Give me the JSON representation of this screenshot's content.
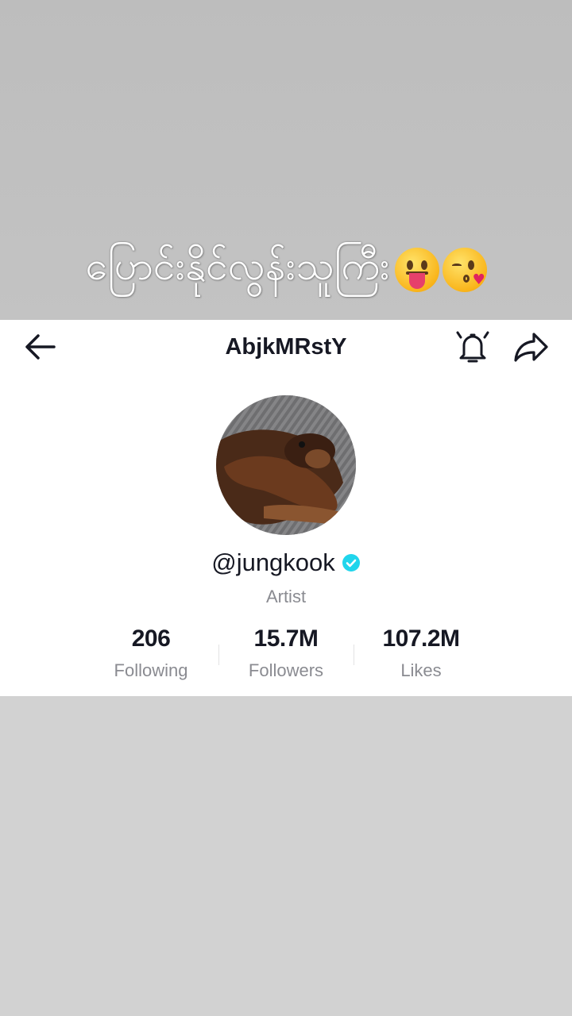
{
  "overlay": {
    "caption": "ပြောင်းနိုင်လွန်းသူကြီး",
    "emojis": [
      "face-with-tongue",
      "face-blowing-kiss"
    ]
  },
  "header": {
    "title": "AbjkMRstY",
    "icons": [
      "back-arrow-icon",
      "bell-icon",
      "share-icon"
    ]
  },
  "profile": {
    "username": "@jungkook",
    "verified": true,
    "bio": "Artist"
  },
  "stats": [
    {
      "value": "206",
      "label": "Following"
    },
    {
      "value": "15.7M",
      "label": "Followers"
    },
    {
      "value": "107.2M",
      "label": "Likes"
    }
  ],
  "colors": {
    "verified": "#20d5ec",
    "text_primary": "#161823",
    "text_secondary": "#8a8b91"
  }
}
